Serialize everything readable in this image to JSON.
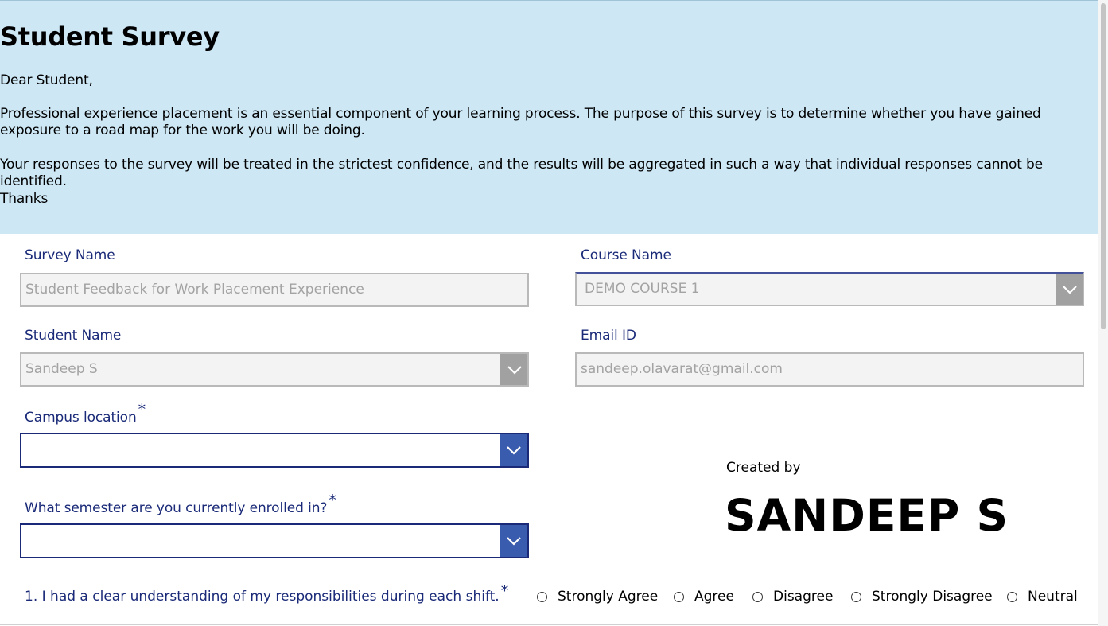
{
  "header": {
    "title": "Student Survey",
    "greeting": "Dear Student,",
    "paragraph1": "Professional experience placement is an essential component of your learning process. The purpose of this survey is to determine whether you have gained exposure to a road map for the work you will be doing.",
    "paragraph2": "Your responses to the survey will be treated in the strictest confidence, and the results will be aggregated in such a way that individual responses cannot be identified.",
    "thanks": "Thanks"
  },
  "form": {
    "survey_name": {
      "label": "Survey Name",
      "value": "Student Feedback for Work Placement Experience"
    },
    "course_name": {
      "label": "Course Name",
      "value": "DEMO COURSE 1"
    },
    "student_name": {
      "label": "Student Name",
      "value": "Sandeep S"
    },
    "email": {
      "label": "Email ID",
      "value": "sandeep.olavarat@gmail.com"
    },
    "campus_location": {
      "label": "Campus location",
      "required_mark": "*",
      "value": ""
    },
    "semester": {
      "label": "What semester are you currently enrolled in?",
      "required_mark": "*",
      "value": ""
    }
  },
  "credit": {
    "created_by": "Created by",
    "author": "SANDEEP S"
  },
  "questions": [
    {
      "text": "1. I had a clear understanding of my responsibilities during each shift.",
      "required_mark": "*",
      "options": [
        "Strongly Agree",
        "Agree",
        "Disagree",
        "Strongly Disagree",
        "Neutral"
      ]
    }
  ],
  "colors": {
    "header_bg": "#cde7f5",
    "label_text": "#1a2a78",
    "dropdown_active": "#3a5cae",
    "dropdown_disabled": "#a1a1a1"
  },
  "icons": {
    "dropdown": "chevron-down-icon",
    "radio": "radio-unchecked-icon"
  }
}
